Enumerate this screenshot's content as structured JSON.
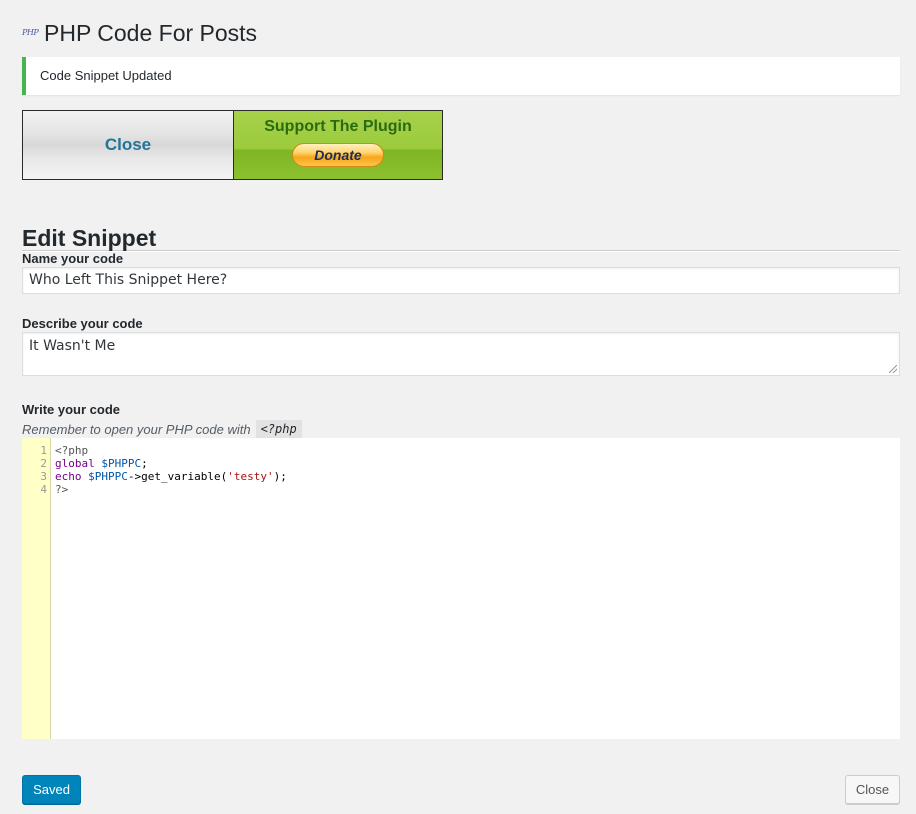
{
  "header": {
    "logo_text": "PHP",
    "title": "PHP Code For Posts"
  },
  "notice": {
    "message": "Code Snippet Updated",
    "color": "#46b450"
  },
  "promo": {
    "close_label": "Close",
    "support_label": "Support The Plugin",
    "donate_label": "Donate"
  },
  "form": {
    "heading": "Edit Snippet",
    "name_label": "Name your code",
    "name_value": "Who Left This Snippet Here?",
    "desc_label": "Describe your code",
    "desc_value": "It Wasn't Me",
    "code_label": "Write your code",
    "code_hint": "Remember to open your PHP code with",
    "code_hint_tag": "<?php"
  },
  "editor": {
    "line_numbers": [
      "1",
      "2",
      "3",
      "4"
    ],
    "lines": [
      {
        "tokens": [
          {
            "t": "<?php",
            "c": "meta"
          }
        ]
      },
      {
        "tokens": [
          {
            "t": "global",
            "c": "kw"
          },
          {
            "t": " ",
            "c": ""
          },
          {
            "t": "$PHPPC",
            "c": "var"
          },
          {
            "t": ";",
            "c": ""
          }
        ]
      },
      {
        "tokens": [
          {
            "t": "echo",
            "c": "kw"
          },
          {
            "t": " ",
            "c": ""
          },
          {
            "t": "$PHPPC",
            "c": "var"
          },
          {
            "t": "->get_variable(",
            "c": ""
          },
          {
            "t": "'testy'",
            "c": "str"
          },
          {
            "t": ");",
            "c": ""
          }
        ]
      },
      {
        "tokens": [
          {
            "t": "?>",
            "c": "meta"
          }
        ]
      }
    ]
  },
  "actions": {
    "save_label": "Saved",
    "close_label": "Close",
    "accent": "#0085ba"
  }
}
